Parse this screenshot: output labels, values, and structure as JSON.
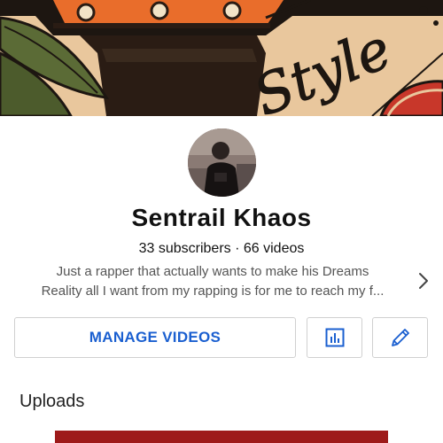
{
  "banner": {
    "text": "Style"
  },
  "channel": {
    "name": "Sentrail Khaos",
    "meta": "33 subscribers · 66 videos",
    "description_line1": "Just a rapper that actually wants to make his Dreams",
    "description_line2": "Reality all I want from my rapping is for me to reach my f..."
  },
  "buttons": {
    "manage_label": "MANAGE VIDEOS",
    "analytics_icon": "bar-chart-icon",
    "edit_icon": "pencil-icon"
  },
  "sections": {
    "uploads_title": "Uploads"
  },
  "colors": {
    "accent": "#1a5fd0",
    "banner_bg": "#e9c79d",
    "video_thumb": "#9e1a1a"
  }
}
